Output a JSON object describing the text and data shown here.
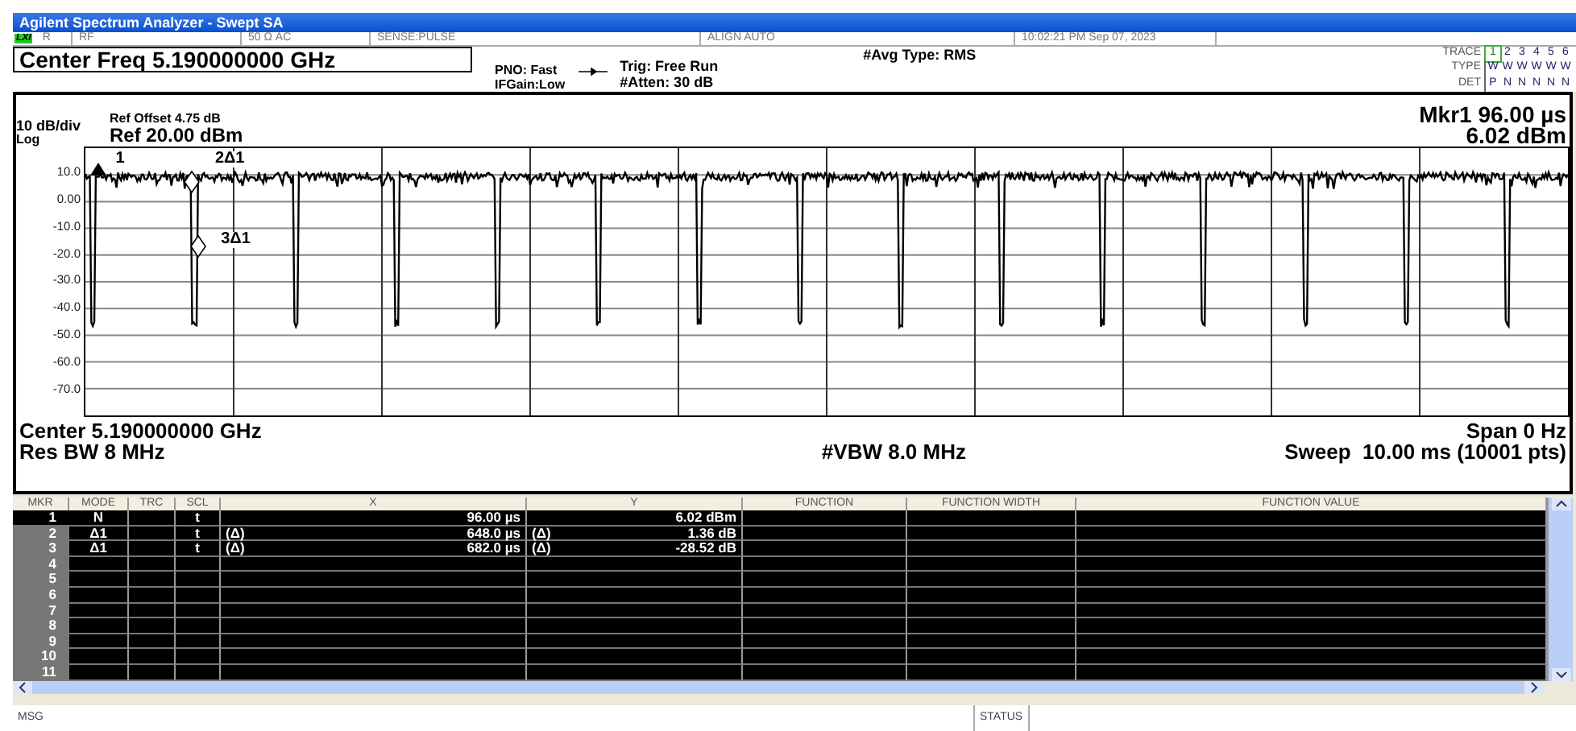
{
  "window": {
    "title": "Agilent Spectrum Analyzer - Swept SA"
  },
  "status_row": {
    "lxi": "LXI",
    "items": [
      "R",
      "RF",
      "50 Ω   AC",
      "SENSE:PULSE",
      "ALIGN AUTO",
      "10:02:21 PM Sep 07, 2023"
    ]
  },
  "center_freq": "Center Freq 5.190000000 GHz",
  "settings": {
    "pno": "PNO: Fast",
    "ifgain": "IFGain:Low",
    "trig": "Trig: Free Run",
    "atten": "#Atten: 30 dB",
    "avg_type": "#Avg Type: RMS"
  },
  "traces": {
    "labels": [
      "TRACE",
      "TYPE",
      "DET"
    ],
    "items": [
      {
        "number": "1",
        "type": "W",
        "det": "P",
        "selected": true
      },
      {
        "number": "2",
        "type": "W",
        "det": "N",
        "selected": false
      },
      {
        "number": "3",
        "type": "W",
        "det": "N",
        "selected": false
      },
      {
        "number": "4",
        "type": "W",
        "det": "N",
        "selected": false
      },
      {
        "number": "5",
        "type": "W",
        "det": "N",
        "selected": false
      },
      {
        "number": "6",
        "type": "W",
        "det": "N",
        "selected": false
      }
    ]
  },
  "graph": {
    "ref_offset": "Ref Offset 4.75 dB",
    "scale": "10 dB/div",
    "ref_level": "Ref 20.00 dBm",
    "scale_type": "Log",
    "marker_x": "Mkr1 96.00 µs",
    "marker_y": "6.02 dBm",
    "y_labels": [
      "10.0",
      "0.00",
      "-10.0",
      "-20.0",
      "-30.0",
      "-40.0",
      "-50.0",
      "-60.0",
      "-70.0"
    ],
    "markers": [
      {
        "label": "1",
        "kind": "normal"
      },
      {
        "label": "2Δ1",
        "kind": "delta"
      },
      {
        "label": "3Δ1",
        "kind": "delta"
      }
    ],
    "center": "Center 5.190000000 GHz",
    "span": "Span 0 Hz",
    "res_bw": "Res BW 8 MHz",
    "vbw": "#VBW 8.0 MHz",
    "sweep": "Sweep  10.00 ms (10001 pts)"
  },
  "table": {
    "columns": [
      "MKR",
      "MODE",
      "TRC",
      "SCL",
      "X",
      "Y",
      "FUNCTION",
      "FUNCTION WIDTH",
      "FUNCTION VALUE"
    ],
    "rows": [
      {
        "mkr": "1",
        "mode": "N",
        "scl": "t",
        "x": "96.00 µs",
        "y": "6.02 dBm",
        "selected": true
      },
      {
        "mkr": "2",
        "mode": "Δ1",
        "scl": "t",
        "x_ref": "(Δ)",
        "x": "648.0 µs",
        "y_ref": "(Δ)",
        "y": "1.36 dB",
        "selected": false
      },
      {
        "mkr": "3",
        "mode": "Δ1",
        "scl": "t",
        "x_ref": "(Δ)",
        "x": "682.0 µs",
        "y_ref": "(Δ)",
        "y": "-28.52 dB",
        "selected": false
      },
      {
        "mkr": "4",
        "selected": false
      },
      {
        "mkr": "5",
        "selected": false
      },
      {
        "mkr": "6",
        "selected": false
      },
      {
        "mkr": "7",
        "selected": false
      },
      {
        "mkr": "8",
        "selected": false
      },
      {
        "mkr": "9",
        "selected": false
      },
      {
        "mkr": "10",
        "selected": false
      },
      {
        "mkr": "11",
        "selected": false
      }
    ]
  },
  "status_bar": {
    "msg": "MSG",
    "status": "STATUS"
  }
}
